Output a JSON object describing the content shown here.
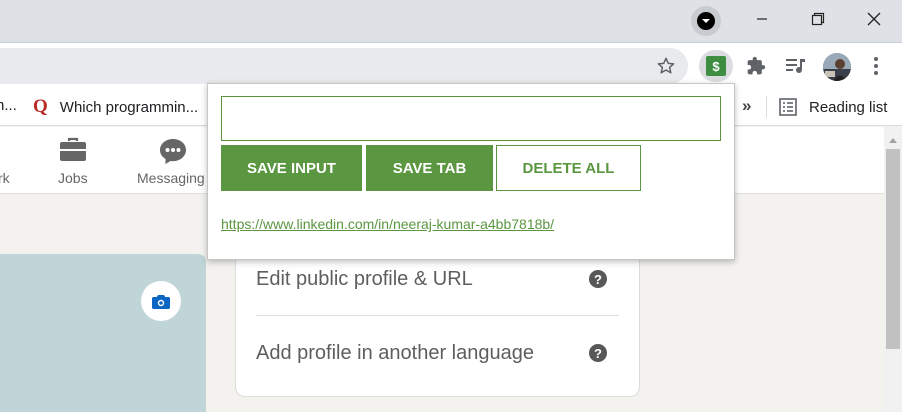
{
  "window": {
    "minimize_glyph": "—",
    "maximize_glyph": "❐",
    "close_glyph": "✕",
    "tab_search_icon": "chevron-down-icon"
  },
  "toolbar": {
    "star_glyph": "☆",
    "extension_badge": "$",
    "extensions_icon": "puzzle-icon",
    "menu_glyph": "⋮"
  },
  "bookmarks": {
    "left_fragment": "n...",
    "quora_icon": "Q",
    "quora_label": "Which programmin...",
    "overflow": "»",
    "reading_list": "Reading list"
  },
  "nav": {
    "partial_label": "rk",
    "jobs": "Jobs",
    "messaging": "Messaging"
  },
  "profile_card": {
    "edit_public_profile": "Edit public profile & URL",
    "add_language": "Add profile in another language",
    "help_glyph": "?"
  },
  "popup": {
    "input_value": "",
    "save_input": "SAVE INPUT",
    "save_tab": "SAVE TAB",
    "delete_all": "DELETE ALL",
    "saved_links": [
      "https://www.linkedin.com/in/neeraj-kumar-a4bb7818b/"
    ]
  },
  "colors": {
    "accent_green": "#5b9641",
    "quora_red": "#b92b27",
    "cover_blue": "#c0d5d8",
    "camera_blue": "#0a66c2"
  }
}
